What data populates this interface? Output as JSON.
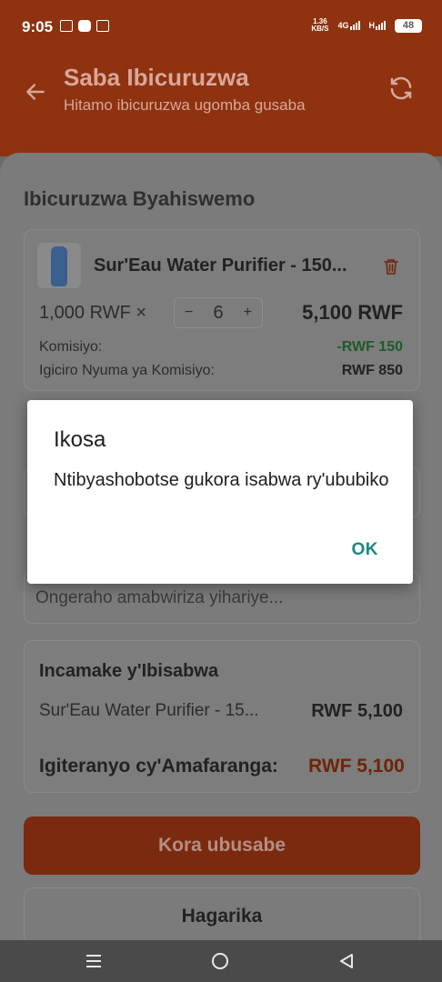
{
  "status_bar": {
    "time": "9:05",
    "speed_value": "1.36",
    "speed_unit": "KB/S",
    "net_left": "4G",
    "net_right": "H",
    "battery": "48"
  },
  "header": {
    "title": "Saba Ibicuruzwa",
    "subtitle": "Hitamo ibicuruzwa ugomba gusaba"
  },
  "selected_section": {
    "title": "Ibicuruzwa Byahiswemo"
  },
  "item": {
    "name": "Sur'Eau Water Purifier - 150...",
    "unit_price": "1,000 RWF ×",
    "qty_minus": "−",
    "qty": "6",
    "qty_plus": "+",
    "line_total": "5,100 RWF",
    "commission_label": "Komisiyo:",
    "commission_value": "-RWF 150",
    "after_commission_label": "Igiciro Nyuma ya Komisiyo:",
    "after_commission_value": "RWF 850"
  },
  "notes": {
    "placeholder": "Ongeraho amabwiriza yihariye..."
  },
  "summary": {
    "title": "Incamake y'Ibisabwa",
    "item_name": "Sur'Eau Water Purifier - 15...",
    "item_value": "RWF 5,100",
    "total_label": "Igiteranyo cy'Amafaranga:",
    "total_value": "RWF 5,100"
  },
  "actions": {
    "submit": "Kora ubusabe",
    "cancel": "Hagarika"
  },
  "dialog": {
    "title": "Ikosa",
    "message": "Ntibyashobotse gukora isabwa ry'ububiko",
    "ok": "OK"
  },
  "colors": {
    "brand": "#c0441a",
    "dialog_accent": "#1c8a82"
  }
}
